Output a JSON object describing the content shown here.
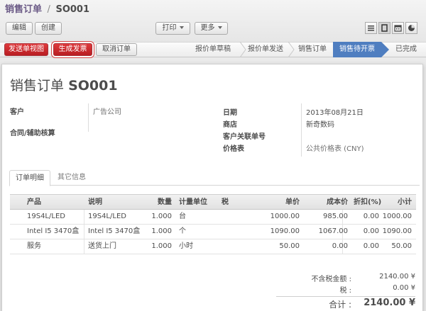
{
  "header": {
    "breadcrumb_parent": "销售订单",
    "breadcrumb_separator": "/",
    "breadcrumb_current": "SO001"
  },
  "toolbar": {
    "edit_label": "编辑",
    "create_label": "创建",
    "print_label": "打印",
    "more_label": "更多"
  },
  "view_switcher": [
    "list-view-icon",
    "form-view-icon",
    "calendar-view-icon",
    "graph-view-icon"
  ],
  "actions": {
    "send_label": "发送单视图",
    "invoice_label": "生成发票",
    "cancel_label": "取消订单"
  },
  "status_stages": [
    {
      "label": "报价单草稿",
      "active": false
    },
    {
      "label": "报价单发送",
      "active": false
    },
    {
      "label": "销售订单",
      "active": false
    },
    {
      "label": "销售待开票",
      "active": true
    },
    {
      "label": "已完成",
      "active": false
    }
  ],
  "document": {
    "title_prefix": "销售订单",
    "title_number": "SO001"
  },
  "fields": {
    "customer_label": "客户",
    "customer_value": "广告公司",
    "contract_label": "合同/辅助核算",
    "date_label": "日期",
    "date_value": "2013年08月21日",
    "shop_label": "商店",
    "shop_value": "新奇数码",
    "customer_ref_label": "客户关联单号",
    "pricelist_label": "价格表",
    "pricelist_value": "公共价格表 (CNY)"
  },
  "tabs": {
    "lines_label": "订单明细",
    "other_label": "其它信息"
  },
  "order_lines": {
    "columns": [
      "产品",
      "说明",
      "数量",
      "计量单位",
      "税",
      "单价",
      "成本价",
      "折扣(%)",
      "小计"
    ],
    "rows": [
      [
        "19S4L/LED",
        "19S4L/LED",
        "1.000",
        "台",
        "",
        "1000.00",
        "985.00",
        "0.00",
        "1000.00"
      ],
      [
        "Intel I5 3470盒",
        "Intel I5 3470盒",
        "1.000",
        "个",
        "",
        "1090.00",
        "1067.00",
        "0.00",
        "1090.00"
      ],
      [
        "服务",
        "送货上门",
        "1.000",
        "小时",
        "",
        "50.00",
        "0.00",
        "0.00",
        "50.00"
      ]
    ]
  },
  "totals": {
    "untaxed_label": "不含税金额 :",
    "untaxed_value": "2140.00 ¥",
    "tax_label": "税 :",
    "tax_value": "0.00 ¥",
    "total_label": "合计 :",
    "total_value": "2140.00 ¥"
  },
  "colors": {
    "accent_blue": "#4f7ec0",
    "action_red": "#c9262b",
    "breadcrumb_purple": "#6b5a86"
  }
}
